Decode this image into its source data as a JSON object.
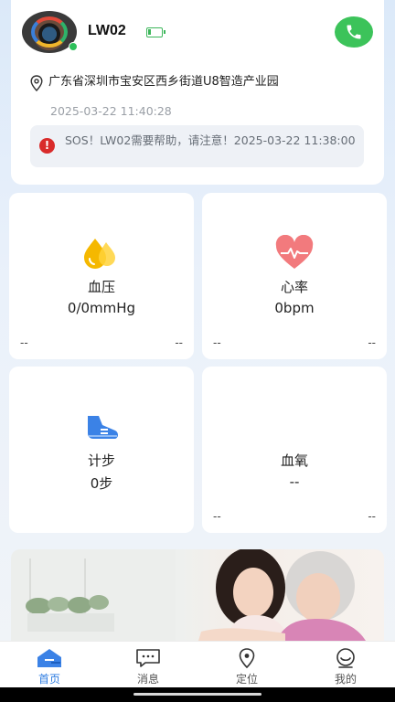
{
  "device": {
    "name": "LW02",
    "address": "广东省深圳市宝安区西乡街道U8智造产业园",
    "timestamp": "2025-03-22 11:40:28",
    "battery_level": 0.2,
    "online": true
  },
  "sos": {
    "message": "SOS！LW02需要帮助，请注意！2025-03-22 11:38:00"
  },
  "metrics": [
    {
      "label": "血压",
      "value": "0/0mmHg",
      "foot_left": "--",
      "foot_right": "--",
      "icon": "blood-drop-icon"
    },
    {
      "label": "心率",
      "value": "0bpm",
      "foot_left": "--",
      "foot_right": "--",
      "icon": "heart-rate-icon"
    },
    {
      "label": "计步",
      "value": "0步",
      "foot_left": "",
      "foot_right": "",
      "icon": "shoe-icon"
    },
    {
      "label": "血氧",
      "value": "--",
      "foot_left": "--",
      "foot_right": "--",
      "icon": ""
    }
  ],
  "tabs": [
    {
      "label": "首页",
      "icon": "home-icon",
      "active": true
    },
    {
      "label": "消息",
      "icon": "message-icon",
      "active": false
    },
    {
      "label": "定位",
      "icon": "location-icon",
      "active": false
    },
    {
      "label": "我的",
      "icon": "profile-icon",
      "active": false
    }
  ],
  "colors": {
    "accent": "#2f7de1",
    "call_green": "#3cc35a",
    "sos_red": "#d92b2b",
    "online_green": "#2dc05a"
  }
}
